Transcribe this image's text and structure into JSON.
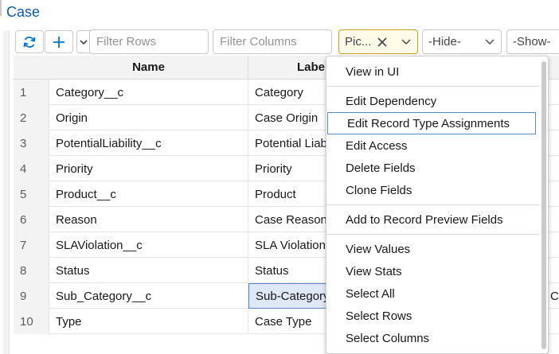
{
  "title": "Case",
  "toolbar": {
    "filter_rows_placeholder": "Filter Rows",
    "filter_columns_placeholder": "Filter Columns",
    "picklist_value": "Pic...",
    "hide_value": "-Hide-",
    "show_value": "-Show-"
  },
  "columns": {
    "name": "Name",
    "label": "Label"
  },
  "rows": [
    {
      "num": "1",
      "name": "Category__c",
      "label": "Category"
    },
    {
      "num": "2",
      "name": "Origin",
      "label": "Case Origin"
    },
    {
      "num": "3",
      "name": "PotentialLiability__c",
      "label": "Potential Liability"
    },
    {
      "num": "4",
      "name": "Priority",
      "label": "Priority"
    },
    {
      "num": "5",
      "name": "Product__c",
      "label": "Product"
    },
    {
      "num": "6",
      "name": "Reason",
      "label": "Case Reason"
    },
    {
      "num": "7",
      "name": "SLAViolation__c",
      "label": "SLA Violation"
    },
    {
      "num": "8",
      "name": "Status",
      "label": "Status"
    },
    {
      "num": "9",
      "name": "Sub_Category__c",
      "label": "Sub-Category",
      "trailing": "C"
    },
    {
      "num": "10",
      "name": "Type",
      "label": "Case Type"
    }
  ],
  "menu": {
    "items": [
      "View in UI",
      "Edit Dependency",
      "Edit Record Type Assignments",
      "Edit Access",
      "Delete Fields",
      "Clone Fields",
      "Add to Record Preview Fields",
      "View Values",
      "View Stats",
      "Select All",
      "Select Rows",
      "Select Columns"
    ]
  }
}
